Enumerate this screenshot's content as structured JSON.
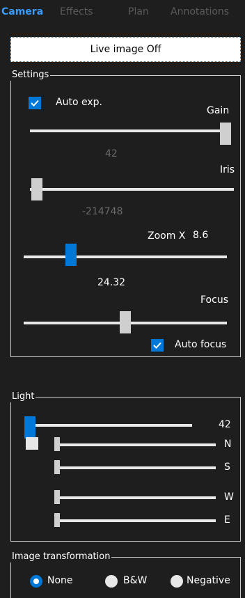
{
  "tabs": [
    {
      "label": "Camera",
      "active": true
    },
    {
      "label": "Effects"
    },
    {
      "label": "Plan"
    },
    {
      "label": "Annotations"
    }
  ],
  "live_button": "Live image Off",
  "settings": {
    "title": "Settings",
    "auto_exp_label": "Auto exp.",
    "auto_exp_checked": true,
    "gain_label": "Gain",
    "gain_value": "42",
    "iris_label": "Iris",
    "iris_value": "-214748",
    "zoom_label": "Zoom X",
    "zoom_factor": "8.6",
    "zoom_value": "24.32",
    "focus_label": "Focus",
    "auto_focus_label": "Auto focus",
    "auto_focus_checked": true
  },
  "light": {
    "title": "Light",
    "intensity_value": "42",
    "sliders": [
      {
        "label": "N"
      },
      {
        "label": "S"
      },
      {
        "label": "W"
      },
      {
        "label": "E"
      }
    ]
  },
  "transformation": {
    "title": "Image transformation",
    "options": [
      {
        "label": "None",
        "selected": true
      },
      {
        "label": "B&W"
      },
      {
        "label": "Negative"
      }
    ]
  }
}
